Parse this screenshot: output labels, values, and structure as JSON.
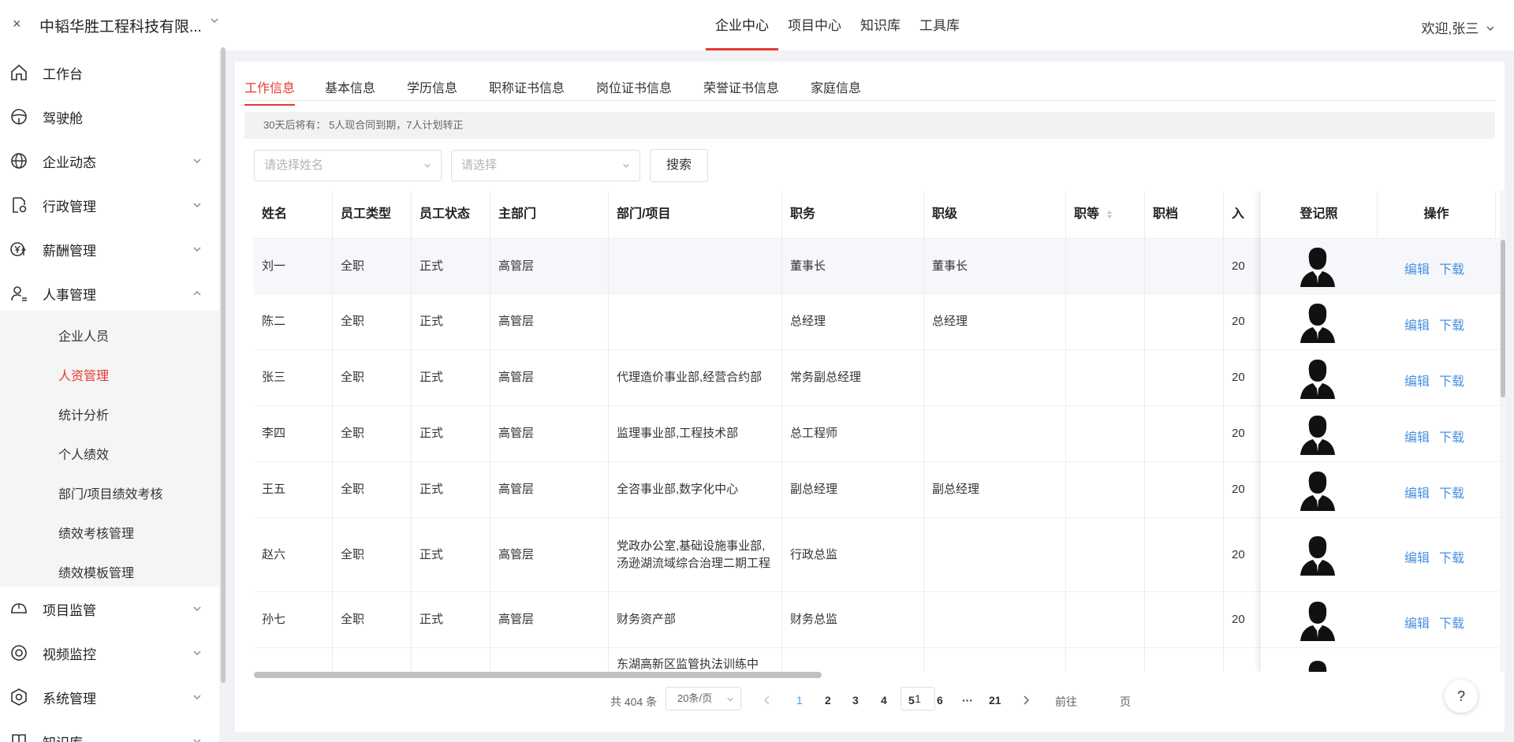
{
  "header": {
    "close_glyph": "×",
    "company": "中韬华胜工程科技有限...",
    "nav": [
      "企业中心",
      "项目中心",
      "知识库",
      "工具库"
    ],
    "active_nav": 0,
    "welcome": "欢迎,张三"
  },
  "sidebar": {
    "items": [
      {
        "label": "工作台",
        "icon": "home-icon"
      },
      {
        "label": "驾驶舱",
        "icon": "steering-wheel-icon"
      },
      {
        "label": "企业动态",
        "icon": "globe-icon"
      },
      {
        "label": "行政管理",
        "icon": "document-gear-icon"
      },
      {
        "label": "薪酬管理",
        "icon": "yen-icon"
      },
      {
        "label": "人事管理",
        "icon": "user-gear-icon"
      },
      {
        "label": "项目监管",
        "icon": "helmet-icon"
      },
      {
        "label": "视频监控",
        "icon": "camera-icon"
      },
      {
        "label": "系统管理",
        "icon": "settings-hexagon-icon"
      },
      {
        "label": "知识库",
        "icon": "book-icon"
      }
    ],
    "submenu": [
      "企业人员",
      "人资管理",
      "统计分析",
      "个人绩效",
      "部门/项目绩效考核",
      "绩效考核管理",
      "绩效模板管理"
    ],
    "active_sub": 1
  },
  "tabs": [
    "工作信息",
    "基本信息",
    "学历信息",
    "职称证书信息",
    "岗位证书信息",
    "荣誉证书信息",
    "家庭信息"
  ],
  "notice": "30天后将有： 5人现合同到期，7人计划转正",
  "filters": {
    "name_placeholder": "请选择姓名",
    "select_placeholder": "请选择",
    "search_label": "搜索"
  },
  "table": {
    "columns": [
      "姓名",
      "员工类型",
      "员工状态",
      "主部门",
      "部门/项目",
      "职务",
      "职级",
      "职等",
      "职档",
      "入"
    ],
    "fixed_columns": [
      "登记照",
      "操作"
    ],
    "actions": {
      "edit": "编辑",
      "download": "下载"
    },
    "rows": [
      {
        "name": "刘一",
        "type": "全职",
        "status": "正式",
        "main_dept": "高管层",
        "dept": "",
        "position": "董事长",
        "rank": "董事长",
        "date": "20"
      },
      {
        "name": "陈二",
        "type": "全职",
        "status": "正式",
        "main_dept": "高管层",
        "dept": "",
        "position": "总经理",
        "rank": "总经理",
        "date": "20"
      },
      {
        "name": "张三",
        "type": "全职",
        "status": "正式",
        "main_dept": "高管层",
        "dept": "代理造价事业部,经营合约部",
        "position": "常务副总经理",
        "rank": "",
        "date": "20"
      },
      {
        "name": "李四",
        "type": "全职",
        "status": "正式",
        "main_dept": "高管层",
        "dept": "监理事业部,工程技术部",
        "position": "总工程师",
        "rank": "",
        "date": "20"
      },
      {
        "name": "王五",
        "type": "全职",
        "status": "正式",
        "main_dept": "高管层",
        "dept": "全咨事业部,数字化中心",
        "position": "副总经理",
        "rank": "副总经理",
        "date": "20"
      },
      {
        "name": "赵六",
        "type": "全职",
        "status": "正式",
        "main_dept": "高管层",
        "dept": "党政办公室,基础设施事业部,汤逊湖流域综合治理二期工程",
        "position": "行政总监",
        "rank": "",
        "date": "20"
      },
      {
        "name": "孙七",
        "type": "全职",
        "status": "正式",
        "main_dept": "高管层",
        "dept": "财务资产部",
        "position": "财务总监",
        "rank": "",
        "date": "20"
      },
      {
        "name": "",
        "type": "",
        "status": "",
        "main_dept": "",
        "dept": "东湖高新区监管执法训练中",
        "position": "",
        "rank": "",
        "date": ""
      }
    ]
  },
  "pagination": {
    "total": "共 404 条",
    "page_size": "20条/页",
    "pages": [
      "1",
      "2",
      "3",
      "4",
      "5",
      "6",
      "···",
      "21"
    ],
    "current": "1",
    "goto_prefix": "前往",
    "goto_value": "1",
    "goto_suffix": "页"
  },
  "help_label": "?",
  "colors": {
    "accent": "#e53935",
    "link": "#4a90e2"
  }
}
